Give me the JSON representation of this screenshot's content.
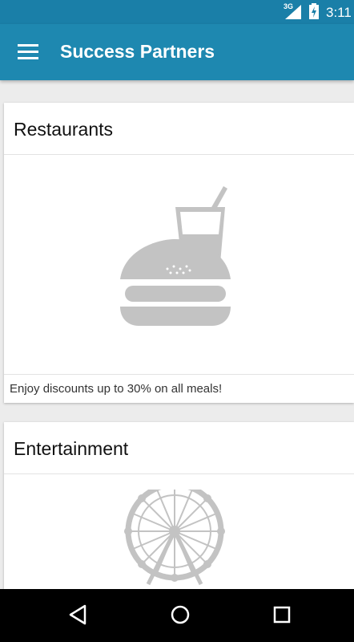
{
  "status_bar": {
    "network": "3G",
    "time": "3:11"
  },
  "app_bar": {
    "title": "Success Partners"
  },
  "cards": [
    {
      "title": "Restaurants",
      "icon": "burger-drink-icon",
      "caption": "Enjoy discounts up to 30% on all meals!"
    },
    {
      "title": "Entertainment",
      "icon": "ferris-wheel-icon"
    }
  ],
  "colors": {
    "status_bar": "#1a7fa8",
    "app_bar": "#1e88b0",
    "icon_gray": "#c3c3c3"
  }
}
